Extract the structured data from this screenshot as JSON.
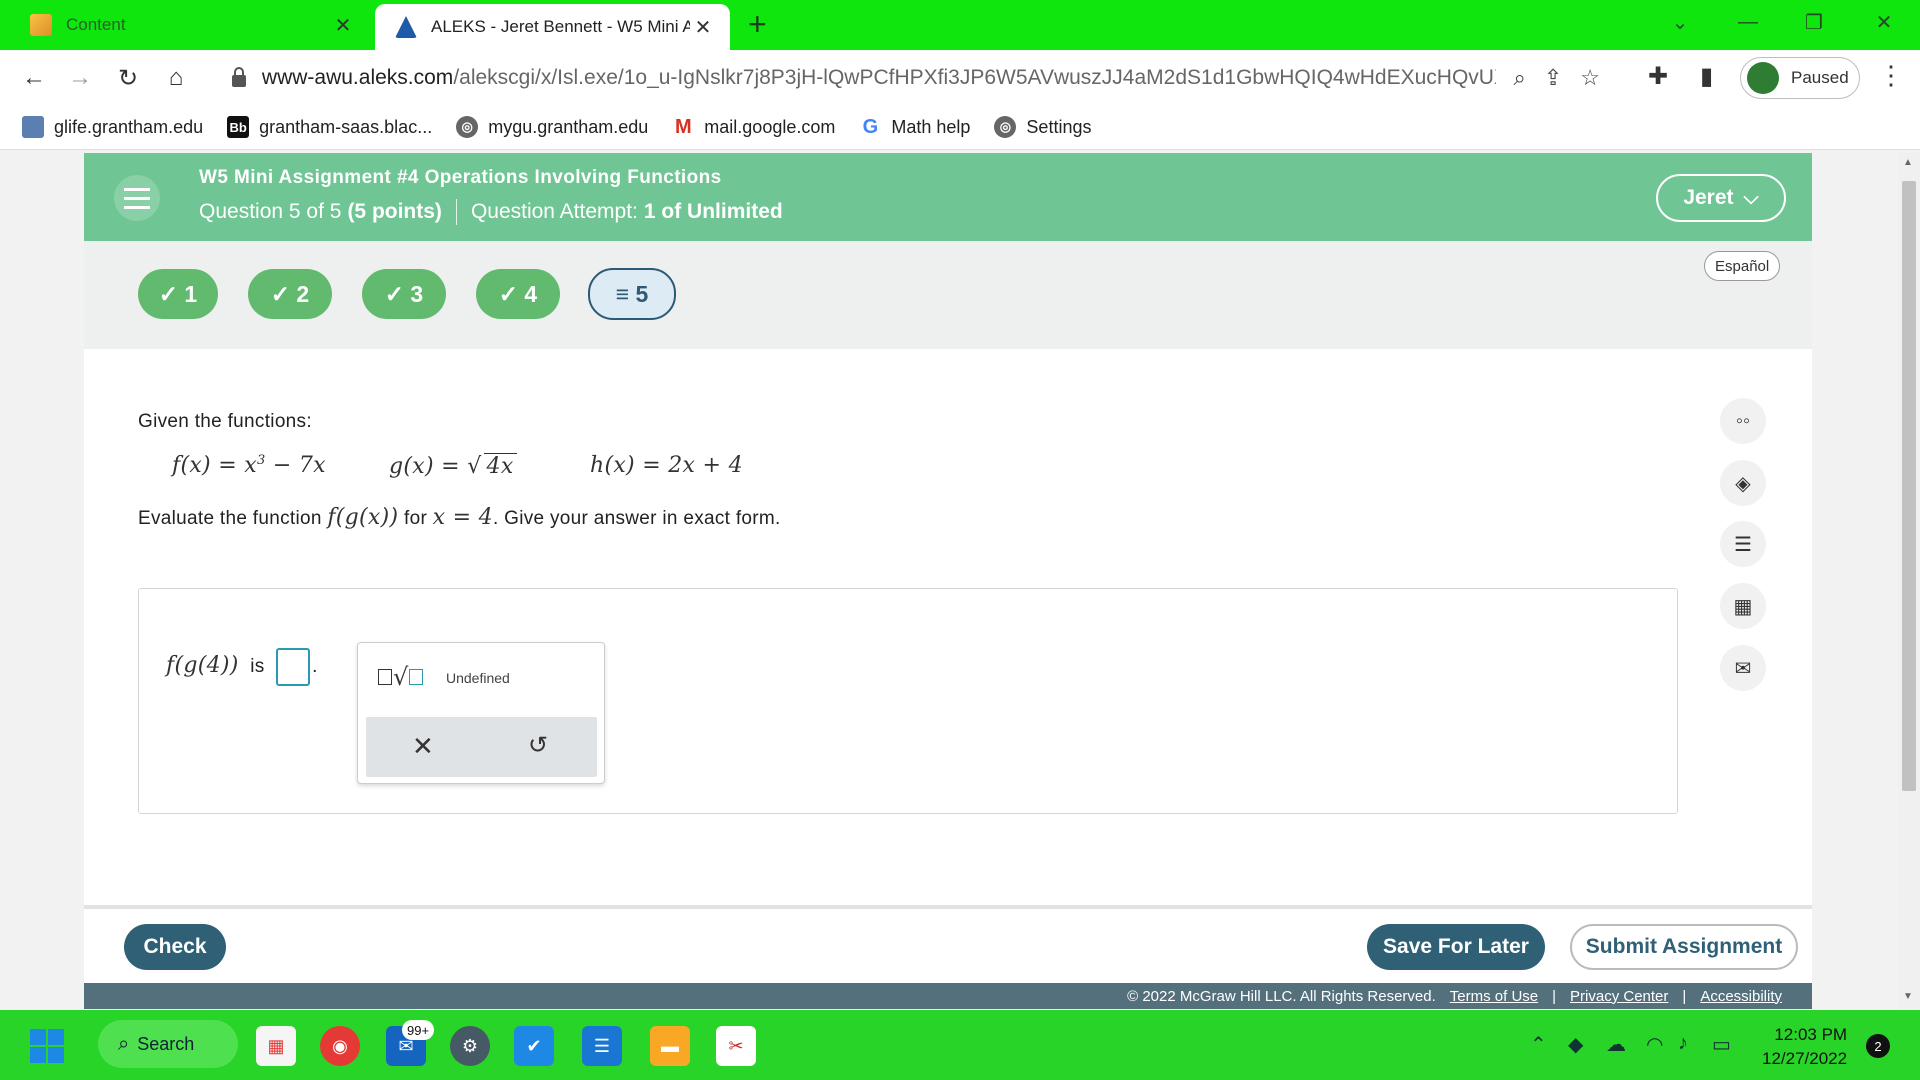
{
  "browser": {
    "tabs": [
      {
        "title": "Content"
      },
      {
        "title": "ALEKS - Jeret Bennett - W5 Mini A"
      }
    ],
    "url_host": "www-awu.aleks.com",
    "url_path": "/alekscgi/x/Isl.exe/1o_u-IgNslkr7j8P3jH-lQwPCfHPXfi3JP6W5AVwuszJJ4aM2dS1d1GbwHQIQ4wHdEXucHQvUX...",
    "profile_label": "Paused",
    "bookmarks": [
      {
        "label": "glife.grantham.edu"
      },
      {
        "label": "grantham-saas.blac..."
      },
      {
        "label": "mygu.grantham.edu"
      },
      {
        "label": "mail.google.com"
      },
      {
        "label": "Math help"
      },
      {
        "label": "Settings"
      }
    ]
  },
  "header": {
    "title": "W5 Mini Assignment #4 Operations Involving Functions",
    "question_prefix": "Question 5 of 5",
    "question_points": "(5 points)",
    "attempt_prefix": "Question Attempt:",
    "attempt_value": "1 of Unlimited",
    "user_name": "Jeret"
  },
  "question_nav": {
    "items": [
      {
        "label": "✓ 1",
        "status": "complete"
      },
      {
        "label": "✓ 2",
        "status": "complete"
      },
      {
        "label": "✓ 3",
        "status": "complete"
      },
      {
        "label": "✓ 4",
        "status": "complete"
      },
      {
        "label": "≡ 5",
        "status": "current"
      }
    ],
    "language_button": "Español"
  },
  "question": {
    "intro": "Given the functions:",
    "f_def": "f(x) = x",
    "f_exp": "3",
    "f_rest": " − 7x",
    "g_def": "g(x) = ",
    "g_rad": "4x",
    "h_def": "h(x) = 2x + 4",
    "prompt_before": "Evaluate the function ",
    "prompt_math": "f(g(x))",
    "prompt_mid": " for ",
    "prompt_x": "x = 4",
    "prompt_after": ". Give your answer in exact form."
  },
  "answer": {
    "lhs": "f(g(4))",
    "is_word": "is",
    "palette_undefined": "Undefined"
  },
  "footer": {
    "check": "Check",
    "save": "Save For Later",
    "submit": "Submit Assignment",
    "copyright": "© 2022 McGraw Hill LLC. All Rights Reserved.",
    "terms": "Terms of Use",
    "privacy": "Privacy Center",
    "accessibility": "Accessibility"
  },
  "taskbar": {
    "search_label": "Search",
    "mail_badge": "99+",
    "time": "12:03 PM",
    "date": "12/27/2022",
    "notifications": "2"
  },
  "colors": {
    "header_green": "#6fc593",
    "nav_complete": "#62ba6f",
    "primary_button": "#2f6076",
    "tabstrip": "#0ee60e",
    "taskbar": "#27d427"
  }
}
